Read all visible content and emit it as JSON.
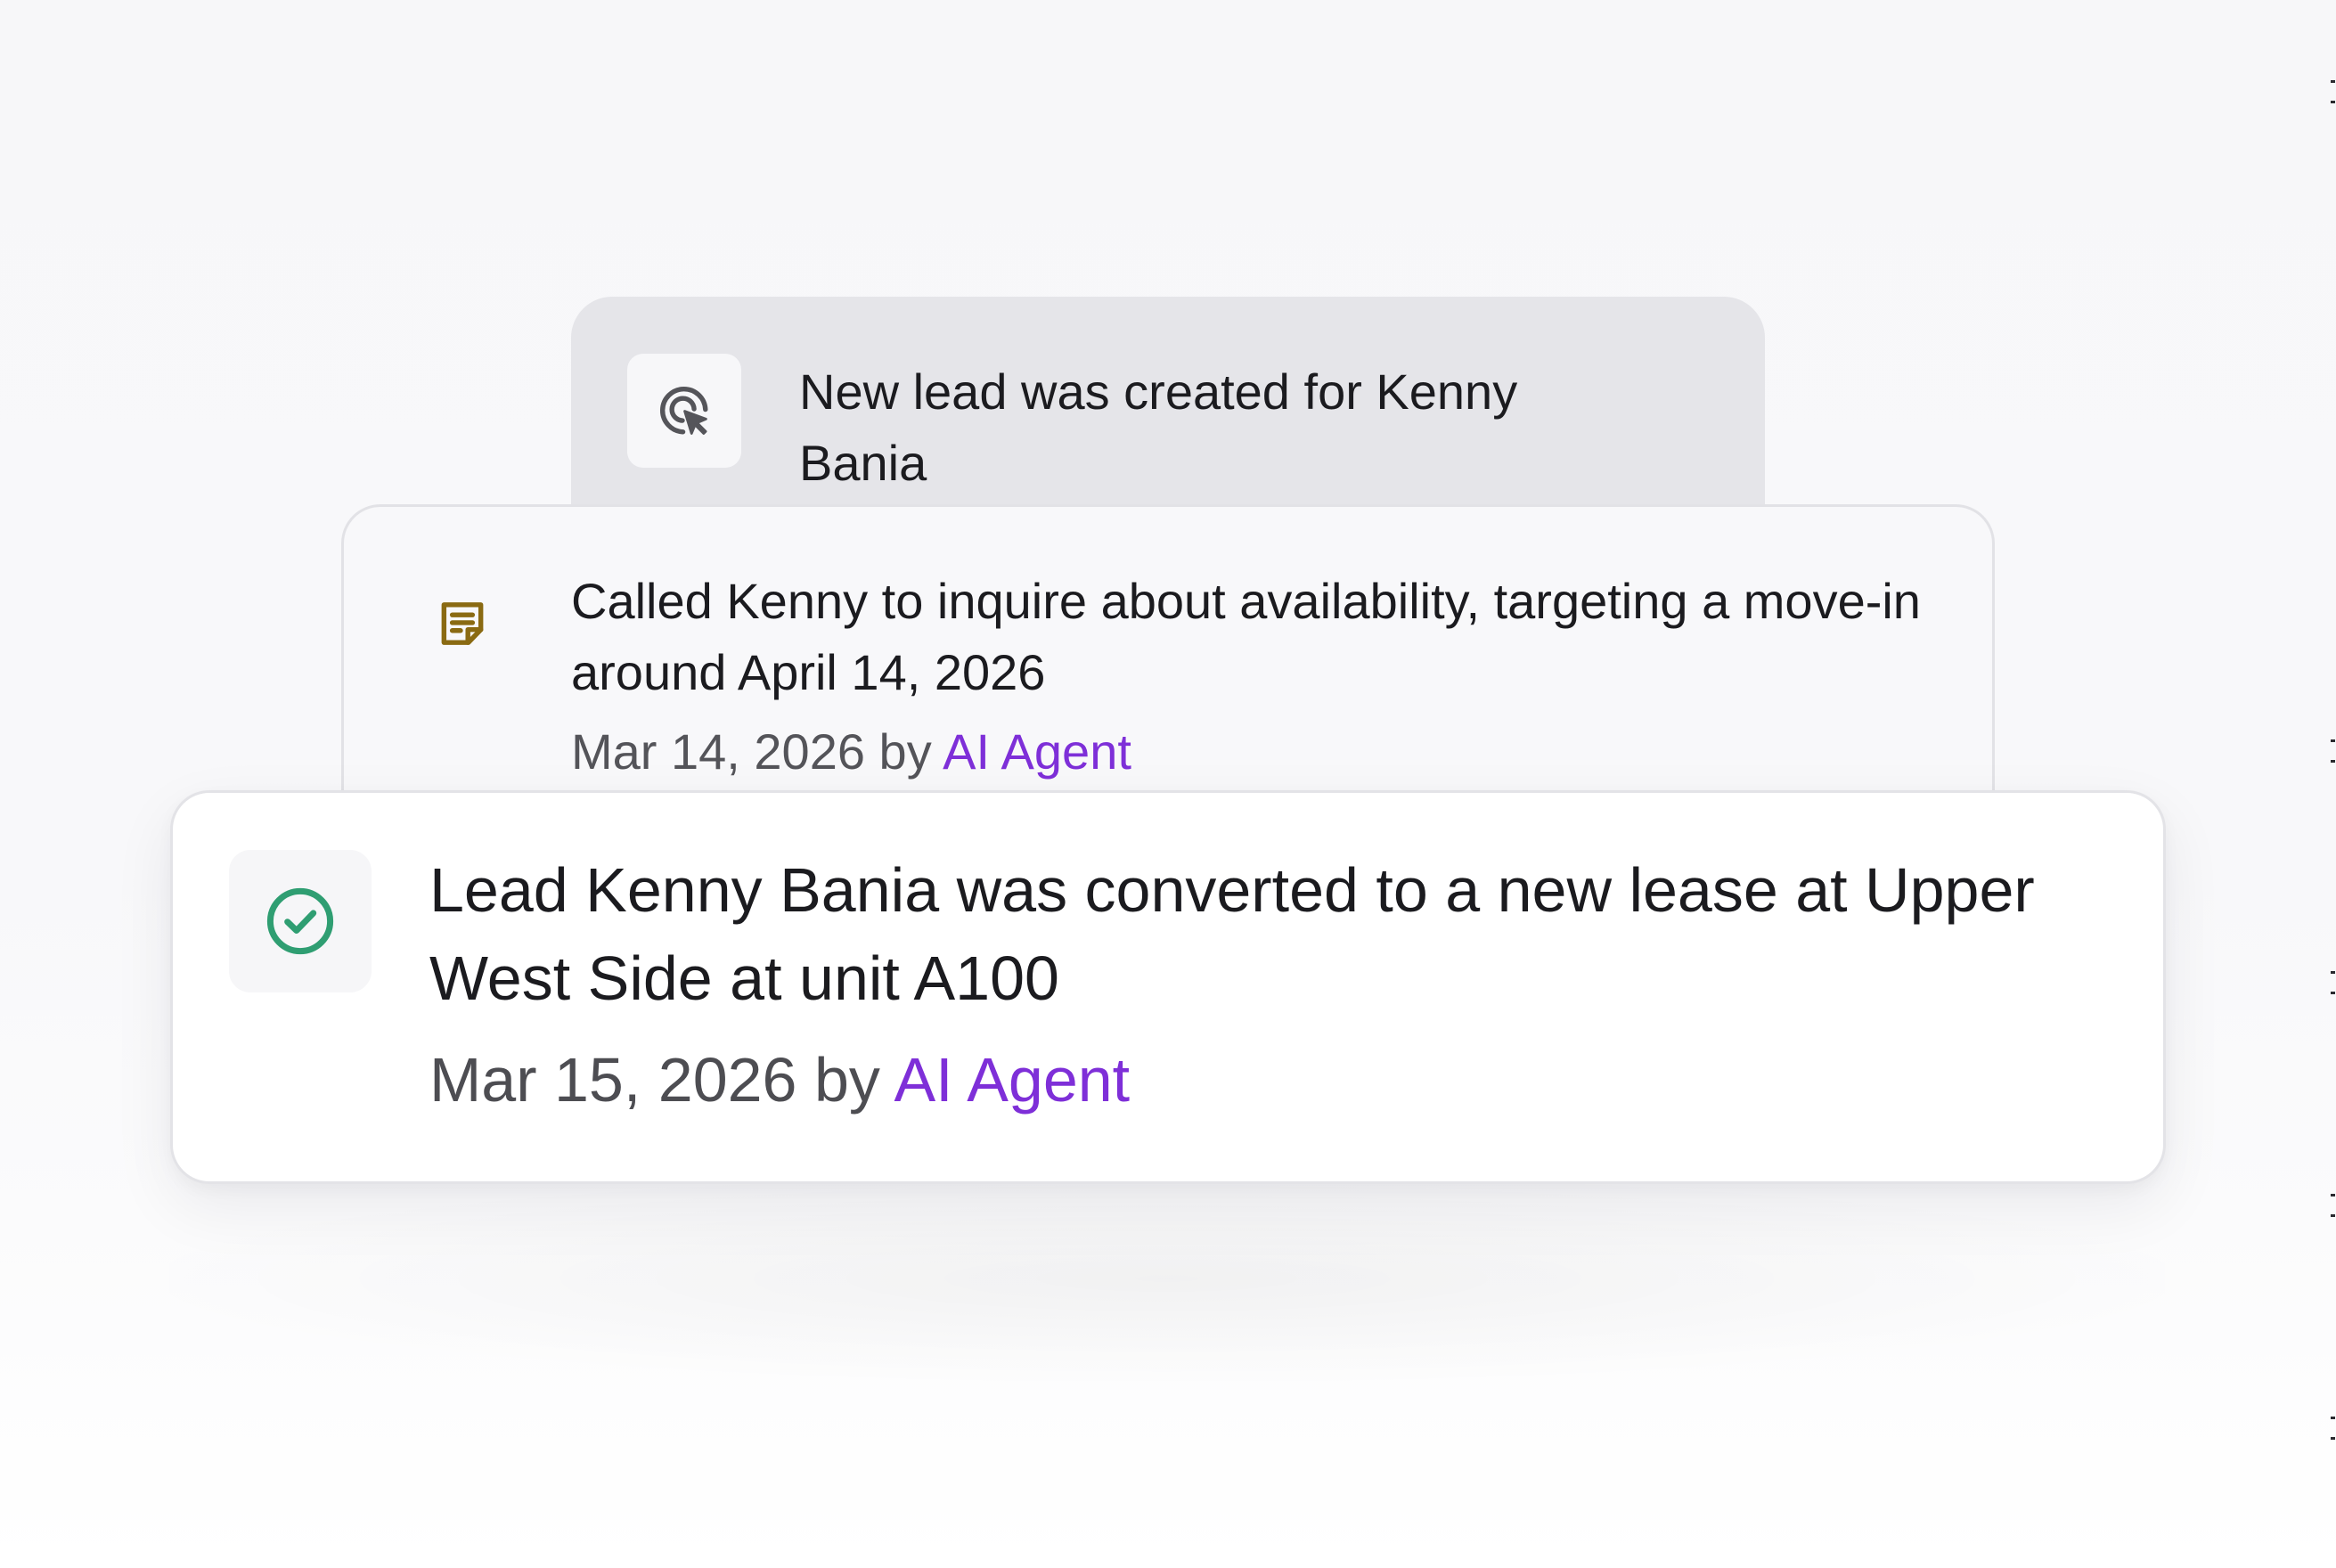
{
  "timeline": {
    "items": [
      {
        "icon": "cursor-target-icon",
        "text": "New lead was created for Kenny Bania"
      },
      {
        "icon": "note-icon",
        "text": "Called Kenny to inquire about availability, targeting a move-in around April 14, 2026",
        "date": "Mar 14, 2026",
        "by_text": "by",
        "author": "AI Agent"
      },
      {
        "icon": "check-circle-icon",
        "text": "Lead Kenny Bania was converted to a new lease at Upper West Side at unit A100",
        "date": "Mar 15, 2026",
        "by_text": "by",
        "author": "AI Agent"
      }
    ]
  },
  "colors": {
    "author_accent": "#7e2fd8",
    "note_icon": "#8a6a12",
    "success_icon": "#2f9e72",
    "muted_icon": "#55555a"
  }
}
